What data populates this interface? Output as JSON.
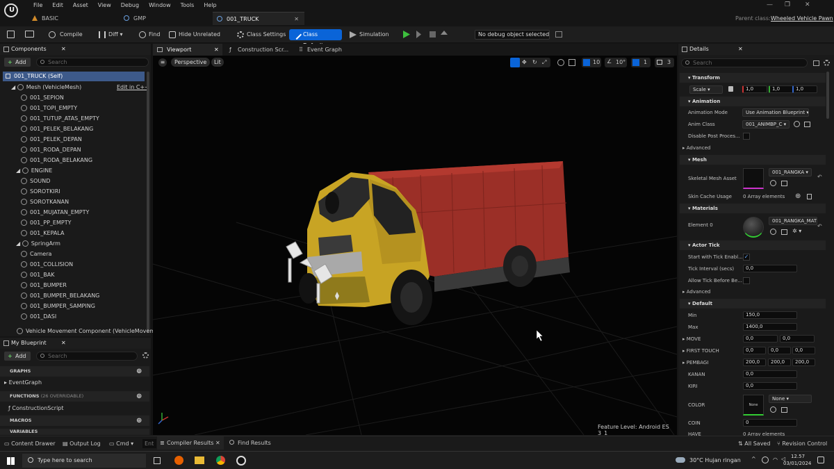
{
  "menu": [
    "File",
    "Edit",
    "Asset",
    "View",
    "Debug",
    "Window",
    "Tools",
    "Help"
  ],
  "tabs": [
    "BASIC",
    "GMP",
    "001_TRUCK"
  ],
  "parent_class_label": "Parent class:",
  "parent_class": "Wheeled Vehicle Pawn",
  "toolbar": {
    "compile": "Compile",
    "diff": "Diff",
    "find": "Find",
    "hide_unrelated": "Hide Unrelated",
    "class_settings": "Class Settings",
    "class_defaults": "Class Defaults",
    "simulation": "Simulation",
    "debug_select": "No debug object selected"
  },
  "components": {
    "title": "Components",
    "add": "Add",
    "search_placeholder": "Search",
    "root": "001_TRUCK (Self)",
    "mesh": "Mesh (VehicleMesh)",
    "edit_cpp": "Edit in C++",
    "items": [
      "001_SEPION",
      "001_TOPI_EMPTY",
      "001_TUTUP_ATAS_EMPTY",
      "001_PELEK_BELAKANG",
      "001_PELEK_DEPAN",
      "001_RODA_DEPAN",
      "001_RODA_BELAKANG",
      "ENGINE",
      "SOUND",
      "SOROTKIRI",
      "SOROTKANAN",
      "001_MUJATAN_EMPTY",
      "001_PP_EMPTY",
      "001_KEPALA",
      "SpringArm",
      "Camera",
      "001_COLLISION",
      "001_BAK",
      "001_BUMPER",
      "001_BUMPER_BELAKANG",
      "001_BUMPER_SAMPING",
      "001_DASI"
    ],
    "movement": "Vehicle Movement Component (VehicleMoveme"
  },
  "blueprint": {
    "title": "My Blueprint",
    "add": "Add",
    "search_placeholder": "Search",
    "graphs": "GRAPHS",
    "event_graph": "EventGraph",
    "functions": "FUNCTIONS",
    "overridable": "(26 OVERRIDABLE)",
    "construction": "ConstructionScript",
    "macros": "MACROS",
    "variables": "VARIABLES"
  },
  "viewport": {
    "tabs": [
      "Viewport",
      "Construction Scr...",
      "Event Graph"
    ],
    "perspective": "Perspective",
    "lit": "Lit",
    "grid": "10",
    "angle": "10°",
    "scale": "1",
    "cams": "3",
    "feature_level": "Feature Level:  Android ES 3_1"
  },
  "details": {
    "title": "Details",
    "search_placeholder": "Search",
    "transform": "Transform",
    "scale_label": "Scale",
    "scale": [
      "1,0",
      "1,0",
      "1,0"
    ],
    "animation": "Animation",
    "anim_mode_label": "Animation Mode",
    "anim_mode": "Use Animation Blueprint",
    "anim_class_label": "Anim Class",
    "anim_class": "001_ANIMBP_C",
    "disable_post": "Disable Post Proces...",
    "advanced": "Advanced",
    "mesh": "Mesh",
    "skel_label": "Skeletal Mesh Asset",
    "skel": "001_RANGKA",
    "skin_cache": "Skin Cache Usage",
    "array_elements": "0 Array elements",
    "materials": "Materials",
    "element0": "Element 0",
    "material": "001_RANGKA_MATE",
    "actor_tick": "Actor Tick",
    "start_tick": "Start with Tick Enabl...",
    "tick_interval": "Tick Interval (secs)",
    "tick_val": "0,0",
    "allow_tick": "Allow Tick Before Be...",
    "default": "Default",
    "min_label": "Min",
    "min": "150,0",
    "max_label": "Max",
    "max": "1400,0",
    "move_label": "MOVE",
    "move": [
      "0,0",
      "0,0"
    ],
    "first_touch_label": "FIRST TOUCH",
    "first_touch": [
      "0,0",
      "0,0",
      "0,0"
    ],
    "pembagi_label": "PEMBAGI",
    "pembagi": [
      "200,0",
      "200,0",
      "200,0"
    ],
    "kanan_label": "KANAN",
    "kanan": "0,0",
    "kiri_label": "KIRI",
    "kiri": "0,0",
    "color_label": "COLOR",
    "color_none": "None",
    "color_drop": "None",
    "coin_label": "COIN",
    "coin": "0",
    "have_label": "HAVE",
    "have": "0 Array elements"
  },
  "bottom": {
    "content_drawer": "Content Drawer",
    "output_log": "Output Log",
    "cmd": "Cmd",
    "ent": "Ent",
    "compiler": "Compiler Results",
    "find_results": "Find Results",
    "all_saved": "All Saved",
    "revision": "Revision Control"
  },
  "taskbar": {
    "search": "Type here to search",
    "weather": "30°C  Hujan ringan",
    "time": "12.57",
    "date": "03/01/2024"
  },
  "colors": {
    "accent": "#0a64d8",
    "truck_yellow": "#c8a424",
    "truck_red": "#9b2f27"
  }
}
